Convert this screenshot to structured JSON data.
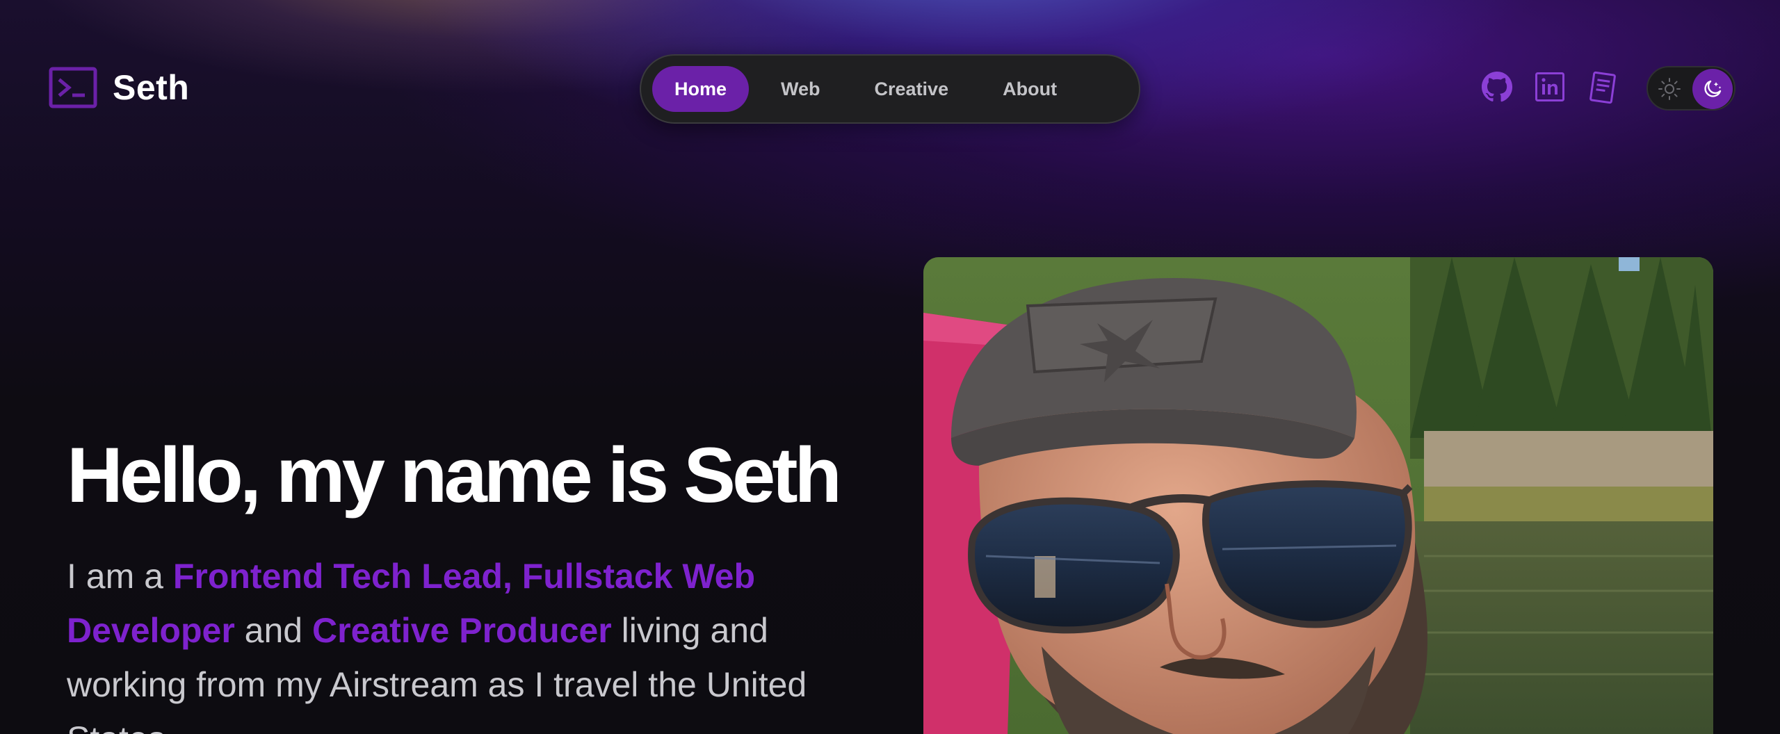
{
  "brand": {
    "name": "Seth",
    "icon": "terminal-prompt-icon"
  },
  "nav": {
    "items": [
      {
        "label": "Home",
        "active": true
      },
      {
        "label": "Web",
        "active": false
      },
      {
        "label": "Creative",
        "active": false
      },
      {
        "label": "About",
        "active": false
      }
    ]
  },
  "social": {
    "links": [
      {
        "icon": "github-icon"
      },
      {
        "icon": "linkedin-icon"
      },
      {
        "icon": "resume-document-icon"
      }
    ]
  },
  "theme_toggle": {
    "mode": "dark",
    "light_icon": "sun-icon",
    "dark_icon": "moon-stars-icon"
  },
  "hero": {
    "title": "Hello, my name is Seth",
    "intro_prefix": "I am a ",
    "role_1": "Frontend Tech Lead, Fullstack Web Developer",
    "connector": " and ",
    "role_2": "Creative Producer",
    "intro_suffix": " living and working from my Airstream as I travel the United States."
  },
  "colors": {
    "accent": "#6b21a8",
    "accent_text": "#7e22ce",
    "background": "#0e0c12",
    "nav_background": "#1f1f21"
  }
}
